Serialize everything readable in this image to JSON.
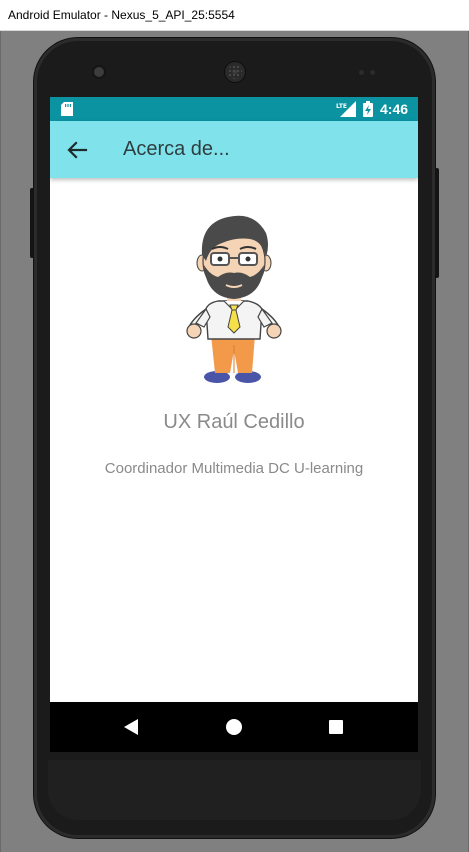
{
  "window": {
    "title": "Android Emulator - Nexus_5_API_25:5554"
  },
  "status_bar": {
    "time": "4:46",
    "network": "LTE",
    "color": "#0b93a2"
  },
  "app_bar": {
    "title": "Acerca de...",
    "color": "#80e3ec"
  },
  "profile": {
    "name": "UX Raúl Cedillo",
    "role": "Coordinador Multimedia DC U-learning",
    "avatar_icon": "cartoon-avatar"
  },
  "nav_bar": {
    "back_icon": "triangle-back-icon",
    "home_icon": "circle-home-icon",
    "recents_icon": "square-recents-icon"
  }
}
